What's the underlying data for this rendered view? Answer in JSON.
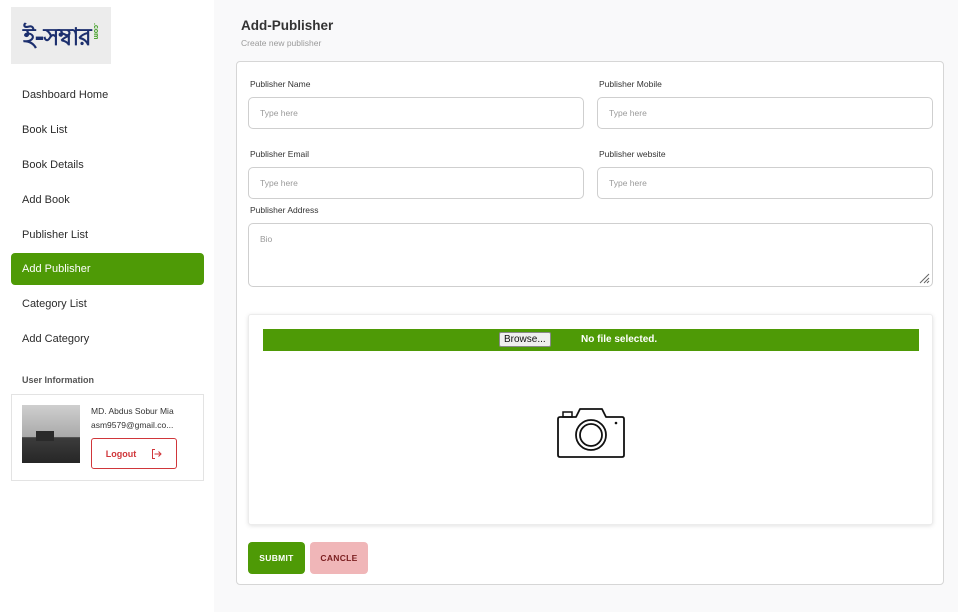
{
  "logo": {
    "text": "ই-সম্বার",
    "suffix": ".com"
  },
  "sidebar": {
    "items": [
      {
        "label": "Dashboard Home"
      },
      {
        "label": "Book List"
      },
      {
        "label": "Book Details"
      },
      {
        "label": "Add Book"
      },
      {
        "label": "Publisher List"
      },
      {
        "label": "Add Publisher",
        "active": true
      },
      {
        "label": "Category List"
      },
      {
        "label": "Add Category"
      }
    ],
    "user_heading": "User Information",
    "user": {
      "name": "MD. Abdus Sobur Mia",
      "email": "asm9579@gmail.co...",
      "logout_label": "Logout"
    }
  },
  "page": {
    "title": "Add-Publisher",
    "subtitle": "Create new publisher"
  },
  "form": {
    "publisher_name": {
      "label": "Publisher Name",
      "placeholder": "Type here"
    },
    "publisher_mobile": {
      "label": "Publisher Mobile",
      "placeholder": "Type here"
    },
    "publisher_email": {
      "label": "Publisher Email",
      "placeholder": "Type here"
    },
    "publisher_website": {
      "label": "Publisher website",
      "placeholder": "Type here"
    },
    "publisher_address": {
      "label": "Publisher Address",
      "placeholder": "Bio"
    },
    "file": {
      "browse_label": "Browse...",
      "status": "No file selected."
    },
    "submit_label": "SUBMIT",
    "cancel_label": "CANCLE"
  },
  "colors": {
    "accent": "#4e9a06",
    "danger": "#d0363a",
    "cancel_bg": "#f0b6b8"
  },
  "icons": {
    "upload_placeholder": "camera-icon",
    "logout": "logout-icon"
  }
}
